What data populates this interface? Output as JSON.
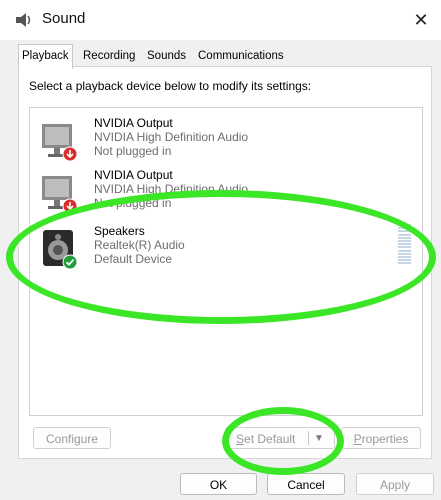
{
  "window": {
    "title": "Sound"
  },
  "tabs": [
    {
      "label": "Playback",
      "active": true
    },
    {
      "label": "Recording"
    },
    {
      "label": "Sounds"
    },
    {
      "label": "Communications"
    }
  ],
  "instruction": "Select a playback device below to modify its settings:",
  "devices": [
    {
      "name": "NVIDIA Output",
      "driver": "NVIDIA High Definition Audio",
      "status": "Not plugged in",
      "icon": "monitor-speaker-icon",
      "badge": "not-plugged-badge-icon"
    },
    {
      "name": "NVIDIA Output",
      "driver": "NVIDIA High Definition Audio",
      "status": "Not plugged in",
      "icon": "monitor-speaker-icon",
      "badge": "not-plugged-badge-icon"
    },
    {
      "name": "Speakers",
      "driver": "Realtek(R) Audio",
      "status": "Default Device",
      "icon": "speaker-icon",
      "badge": "default-check-icon"
    }
  ],
  "panel_buttons": {
    "configure": "Configure",
    "set_default_prefix": "S",
    "set_default_rest": "et Default",
    "properties_prefix": "P",
    "properties_rest": "roperties"
  },
  "footer_buttons": {
    "ok": "OK",
    "cancel": "Cancel",
    "apply": "Apply"
  },
  "colors": {
    "annotation": "#3ae626",
    "unplugged_badge": "#d92c2c",
    "default_badge": "#1f9e3b"
  }
}
